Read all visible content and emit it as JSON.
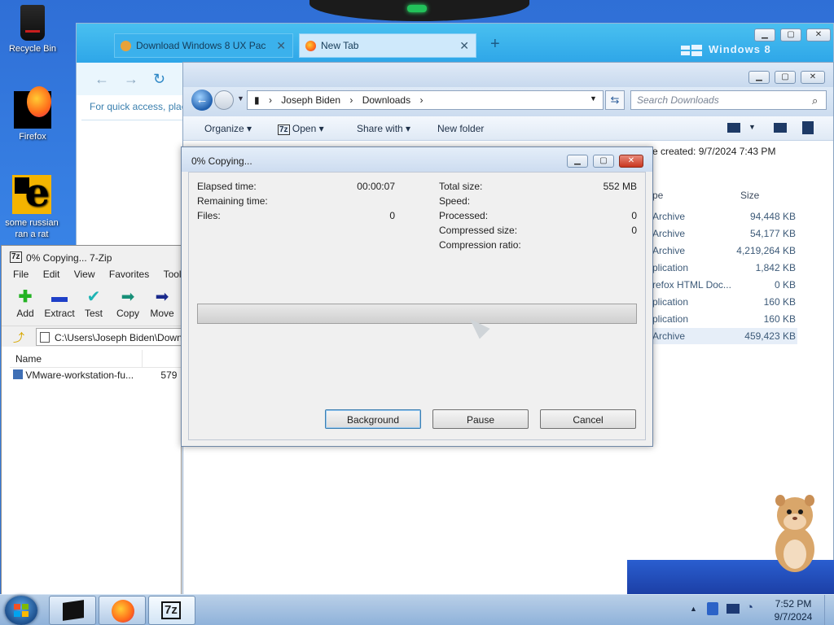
{
  "desktop": {
    "icons": [
      {
        "label": "Recycle Bin"
      },
      {
        "label": "Firefox"
      },
      {
        "label": "some russian ran a rat"
      }
    ]
  },
  "browser": {
    "tabs": [
      {
        "title": "Download Windows 8 UX Pac"
      },
      {
        "title": "New Tab"
      }
    ],
    "new_tab_symbol": "+",
    "brand_label": "Windows 8",
    "quick_access_text": "For quick access, plac"
  },
  "explorer": {
    "breadcrumb": [
      "Joseph Biden",
      "Downloads"
    ],
    "search_placeholder": "Search Downloads",
    "commands": {
      "organize": "Organize",
      "open": "Open",
      "open_badge": "7z",
      "share": "Share with",
      "new_folder": "New folder"
    },
    "date_created": "e created: 9/7/2024 7:43 PM",
    "columns": {
      "type": "pe",
      "size": "Size"
    },
    "rows": [
      {
        "type": "Archive",
        "size": "94,448 KB"
      },
      {
        "type": "Archive",
        "size": "54,177 KB"
      },
      {
        "type": "Archive",
        "size": "4,219,264 KB"
      },
      {
        "type": "plication",
        "size": "1,842 KB"
      },
      {
        "type": "refox HTML Doc...",
        "size": "0 KB"
      },
      {
        "type": "plication",
        "size": "160 KB"
      },
      {
        "type": "plication",
        "size": "160 KB"
      },
      {
        "type": "Archive",
        "size": "459,423 KB"
      }
    ]
  },
  "zip": {
    "title": "0% Copying... 7-Zip",
    "title_badge": "7z",
    "menu": [
      "File",
      "Edit",
      "View",
      "Favorites",
      "Tools"
    ],
    "tools": [
      {
        "label": "Add"
      },
      {
        "label": "Extract"
      },
      {
        "label": "Test"
      },
      {
        "label": "Copy"
      },
      {
        "label": "Move"
      }
    ],
    "path": "C:\\Users\\Joseph Biden\\Down",
    "list_header": "Name",
    "file": {
      "name": "VMware-workstation-fu...",
      "size": "579"
    }
  },
  "dialog": {
    "title": "0% Copying...",
    "left": [
      {
        "label": "Elapsed time:",
        "value": "00:00:07"
      },
      {
        "label": "Remaining time:",
        "value": ""
      },
      {
        "label": "Files:",
        "value": "0"
      }
    ],
    "right": [
      {
        "label": "Total size:",
        "value": "552 MB"
      },
      {
        "label": "Speed:",
        "value": ""
      },
      {
        "label": "Processed:",
        "value": "0"
      },
      {
        "label": "Compressed size:",
        "value": "0"
      },
      {
        "label": "Compression ratio:",
        "value": ""
      }
    ],
    "progress_fraction": 0,
    "buttons": {
      "background": "Background",
      "pause": "Pause",
      "cancel": "Cancel"
    }
  },
  "taskbar": {
    "zip_badge": "7z",
    "time": "7:52 PM",
    "date": "9/7/2024"
  },
  "colors": {
    "desktop": "#2f6fd6",
    "browser_tabbar": "#2ea6e8",
    "progress_fill": "#3cb43c"
  }
}
